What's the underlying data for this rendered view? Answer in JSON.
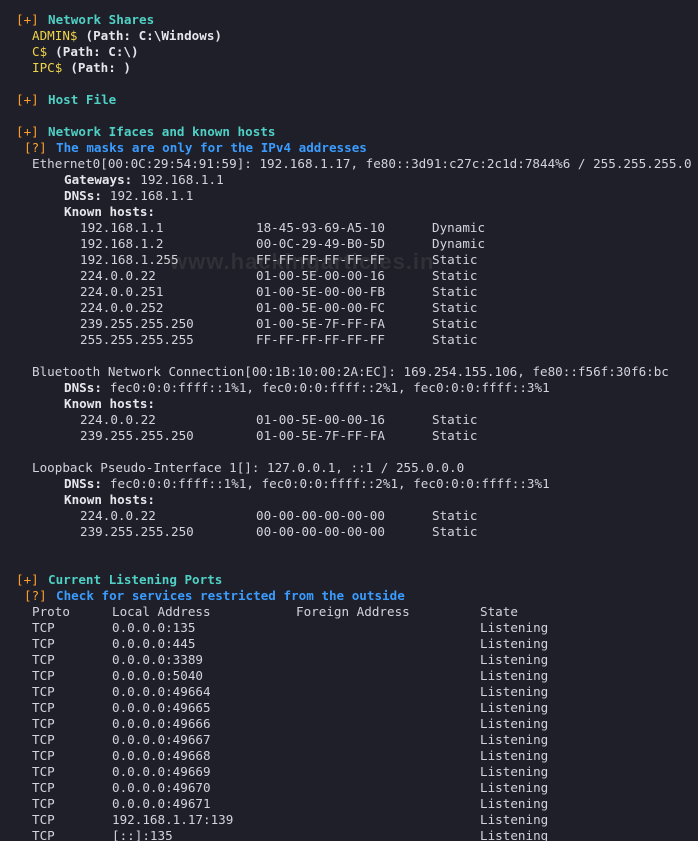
{
  "brackets": {
    "info": "[+]",
    "hint": "[?]"
  },
  "shares": {
    "header": "Network Shares",
    "items": [
      {
        "name": "ADMIN$",
        "path": "(Path: C:\\Windows)"
      },
      {
        "name": "C$",
        "path": "(Path: C:\\)"
      },
      {
        "name": "IPC$",
        "path": "(Path: )"
      }
    ]
  },
  "hostfile": {
    "header": "Host File"
  },
  "network": {
    "header": "Network Ifaces and known hosts",
    "hint": "The masks are only for the IPv4 addresses",
    "labels": {
      "gateways": "Gateways:",
      "dnss": "DNSs:",
      "known": "Known hosts:"
    },
    "ifaces": [
      {
        "title": "Ethernet0[00:0C:29:54:91:59]: 192.168.1.17, fe80::3d91:c27c:2c1d:7844%6 / 255.255.255.0",
        "gateways": "192.168.1.1",
        "dnss": "192.168.1.1",
        "hosts": [
          [
            "192.168.1.1",
            "18-45-93-69-A5-10",
            "Dynamic"
          ],
          [
            "192.168.1.2",
            "00-0C-29-49-B0-5D",
            "Dynamic"
          ],
          [
            "192.168.1.255",
            "FF-FF-FF-FF-FF-FF",
            "Static"
          ],
          [
            "224.0.0.22",
            "01-00-5E-00-00-16",
            "Static"
          ],
          [
            "224.0.0.251",
            "01-00-5E-00-00-FB",
            "Static"
          ],
          [
            "224.0.0.252",
            "01-00-5E-00-00-FC",
            "Static"
          ],
          [
            "239.255.255.250",
            "01-00-5E-7F-FF-FA",
            "Static"
          ],
          [
            "255.255.255.255",
            "FF-FF-FF-FF-FF-FF",
            "Static"
          ]
        ]
      },
      {
        "title": "Bluetooth Network Connection[00:1B:10:00:2A:EC]: 169.254.155.106, fe80::f56f:30f6:bc",
        "dnss": "fec0:0:0:ffff::1%1, fec0:0:0:ffff::2%1, fec0:0:0:ffff::3%1",
        "hosts": [
          [
            "224.0.0.22",
            "01-00-5E-00-00-16",
            "Static"
          ],
          [
            "239.255.255.250",
            "01-00-5E-7F-FF-FA",
            "Static"
          ]
        ]
      },
      {
        "title": "Loopback Pseudo-Interface 1[]: 127.0.0.1, ::1 / 255.0.0.0",
        "dnss": "fec0:0:0:ffff::1%1, fec0:0:0:ffff::2%1, fec0:0:0:ffff::3%1",
        "hosts": [
          [
            "224.0.0.22",
            "00-00-00-00-00-00",
            "Static"
          ],
          [
            "239.255.255.250",
            "00-00-00-00-00-00",
            "Static"
          ]
        ]
      }
    ]
  },
  "ports": {
    "header": "Current Listening Ports",
    "hint": "Check for services restricted from the outside",
    "columns": [
      "Proto",
      "Local Address",
      "Foreign Address",
      "State"
    ],
    "rows": [
      [
        "TCP",
        "0.0.0.0:135",
        "",
        "Listening"
      ],
      [
        "TCP",
        "0.0.0.0:445",
        "",
        "Listening"
      ],
      [
        "TCP",
        "0.0.0.0:3389",
        "",
        "Listening"
      ],
      [
        "TCP",
        "0.0.0.0:5040",
        "",
        "Listening"
      ],
      [
        "TCP",
        "0.0.0.0:49664",
        "",
        "Listening"
      ],
      [
        "TCP",
        "0.0.0.0:49665",
        "",
        "Listening"
      ],
      [
        "TCP",
        "0.0.0.0:49666",
        "",
        "Listening"
      ],
      [
        "TCP",
        "0.0.0.0:49667",
        "",
        "Listening"
      ],
      [
        "TCP",
        "0.0.0.0:49668",
        "",
        "Listening"
      ],
      [
        "TCP",
        "0.0.0.0:49669",
        "",
        "Listening"
      ],
      [
        "TCP",
        "0.0.0.0:49670",
        "",
        "Listening"
      ],
      [
        "TCP",
        "0.0.0.0:49671",
        "",
        "Listening"
      ],
      [
        "TCP",
        "192.168.1.17:139",
        "",
        "Listening"
      ],
      [
        "TCP",
        "[::]:135",
        "",
        "Listening"
      ]
    ]
  },
  "watermark": "www.hackingarticles.in"
}
